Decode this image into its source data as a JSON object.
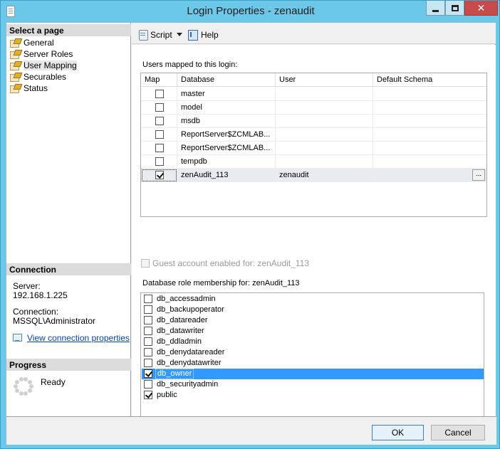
{
  "window": {
    "title": "Login Properties - zenaudit"
  },
  "left": {
    "select_page_header": "Select a page",
    "pages": [
      {
        "label": "General"
      },
      {
        "label": "Server Roles"
      },
      {
        "label": "User Mapping"
      },
      {
        "label": "Securables"
      },
      {
        "label": "Status"
      }
    ],
    "selected_page": "User Mapping",
    "connection_header": "Connection",
    "server_label": "Server:",
    "server_value": "192.168.1.225",
    "connection_label": "Connection:",
    "connection_value": "MSSQL\\Administrator",
    "view_connection_link": "View connection properties",
    "progress_header": "Progress",
    "progress_status": "Ready"
  },
  "toolbar": {
    "script_label": "Script",
    "help_label": "Help"
  },
  "mapping": {
    "label": "Users mapped to this login:",
    "columns": [
      "Map",
      "Database",
      "User",
      "Default Schema"
    ],
    "rows": [
      {
        "map": false,
        "database": "master",
        "user": "",
        "schema": ""
      },
      {
        "map": false,
        "database": "model",
        "user": "",
        "schema": ""
      },
      {
        "map": false,
        "database": "msdb",
        "user": "",
        "schema": ""
      },
      {
        "map": false,
        "database": "ReportServer$ZCMLAB...",
        "user": "",
        "schema": ""
      },
      {
        "map": false,
        "database": "ReportServer$ZCMLAB...",
        "user": "",
        "schema": ""
      },
      {
        "map": false,
        "database": "tempdb",
        "user": "",
        "schema": ""
      },
      {
        "map": true,
        "database": "zenAudit_113",
        "user": "zenaudit",
        "schema": ""
      }
    ],
    "ellipsis": "..."
  },
  "guest": {
    "label": "Guest account enabled for: zenAudit_113",
    "checked": false
  },
  "roles": {
    "label": "Database role membership for: zenAudit_113",
    "items": [
      {
        "name": "db_accessadmin",
        "checked": false
      },
      {
        "name": "db_backupoperator",
        "checked": false
      },
      {
        "name": "db_datareader",
        "checked": false
      },
      {
        "name": "db_datawriter",
        "checked": false
      },
      {
        "name": "db_ddladmin",
        "checked": false
      },
      {
        "name": "db_denydatareader",
        "checked": false
      },
      {
        "name": "db_denydatawriter",
        "checked": false
      },
      {
        "name": "db_owner",
        "checked": true
      },
      {
        "name": "db_securityadmin",
        "checked": false
      },
      {
        "name": "public",
        "checked": true
      }
    ],
    "selected": "db_owner"
  },
  "buttons": {
    "ok": "OK",
    "cancel": "Cancel"
  },
  "colors": {
    "frame": "#6cc8e8",
    "close_button": "#c74b4b",
    "selection": "#3399ff"
  }
}
